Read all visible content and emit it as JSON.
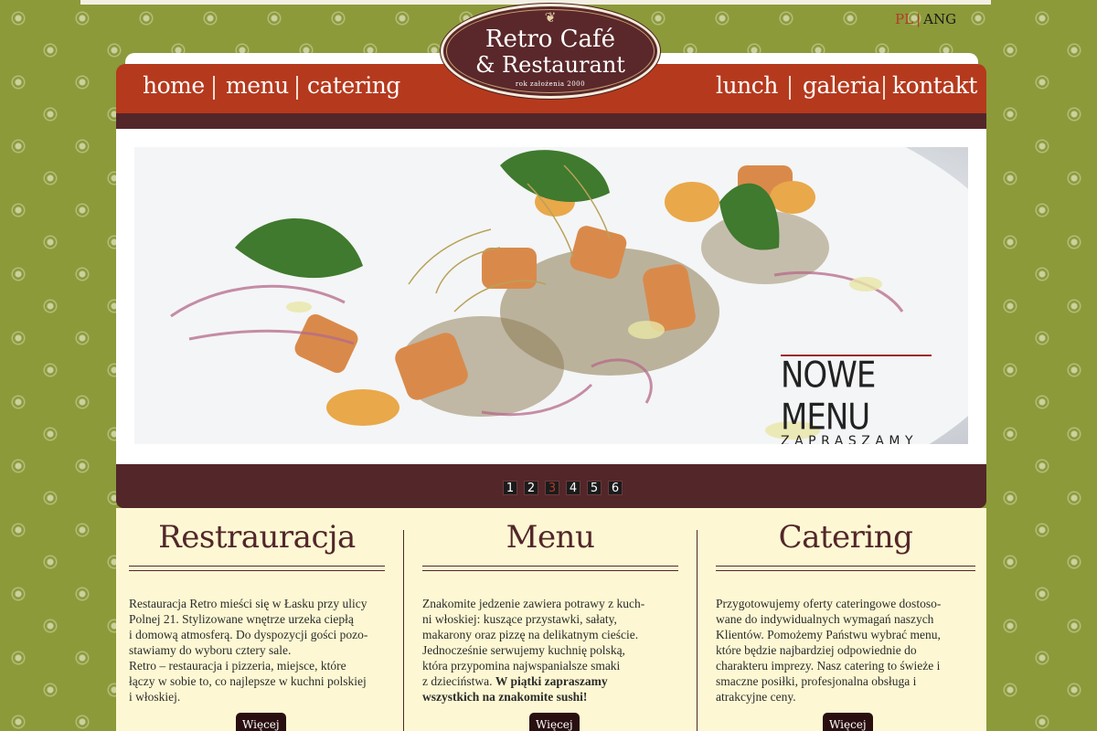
{
  "language": {
    "pl": "PL",
    "separator": "|",
    "ang": "ANG"
  },
  "logo": {
    "line1": "Retro Café",
    "line2": "& Restaurant",
    "line3": "rok założenia 2000"
  },
  "nav": {
    "left": [
      "home",
      "menu",
      "catering"
    ],
    "right": [
      "lunch",
      "galeria",
      "kontakt"
    ]
  },
  "slider": {
    "caption_big": "NOWE MENU",
    "caption_small": "ZAPRASZAMY",
    "pages": [
      "1",
      "2",
      "3",
      "4",
      "5",
      "6"
    ],
    "active_page": "3"
  },
  "columns": [
    {
      "title": "Restrauracja",
      "text": [
        "Restauracja Retro mieści się w Łasku przy ulicy",
        "Polnej 21. Stylizowane wnętrze urzeka ciepłą",
        "i domową atmosferą. Do dyspozycji gości pozo-",
        "stawiamy do wyboru cztery sale.",
        "Retro – restauracja i pizzeria, miejsce, które",
        "łączy w sobie to, co najlepsze w kuchni polskiej",
        "i włoskiej."
      ],
      "button": "Więcej"
    },
    {
      "title": "Menu",
      "text": [
        "Znakomite jedzenie zawiera potrawy z kuch-",
        "ni włoskiej: kuszące przystawki, sałaty,",
        "makarony oraz pizzę na delikatnym cieście.",
        "Jednocześnie serwujemy kuchnię polską,",
        "która przypomina najwspanialsze smaki"
      ],
      "text_last": "z dzieciństwa.",
      "text_bold": [
        "W piątki zapraszamy",
        "wszystkich na znakomite sushi!"
      ],
      "button": "Więcej"
    },
    {
      "title": "Catering",
      "text": [
        "Przygotowujemy oferty cateringowe dostoso-",
        "wane do indywidualnych wymagań naszych",
        "Klientów. Pomożemy Państwu wybrać menu,",
        "które będzie najbardziej odpowiednie do",
        "charakteru imprezy. Nasz catering to świeże i",
        "smaczne posiłki, profesjonalna obsługa i",
        "atrakcyjne ceny."
      ],
      "button": "Więcej"
    }
  ],
  "colors": {
    "background": "#8c9a3a",
    "nav": "#b5391d",
    "band": "#53262a",
    "content_bg": "#fdf8d3",
    "button": "#2a0f10"
  }
}
